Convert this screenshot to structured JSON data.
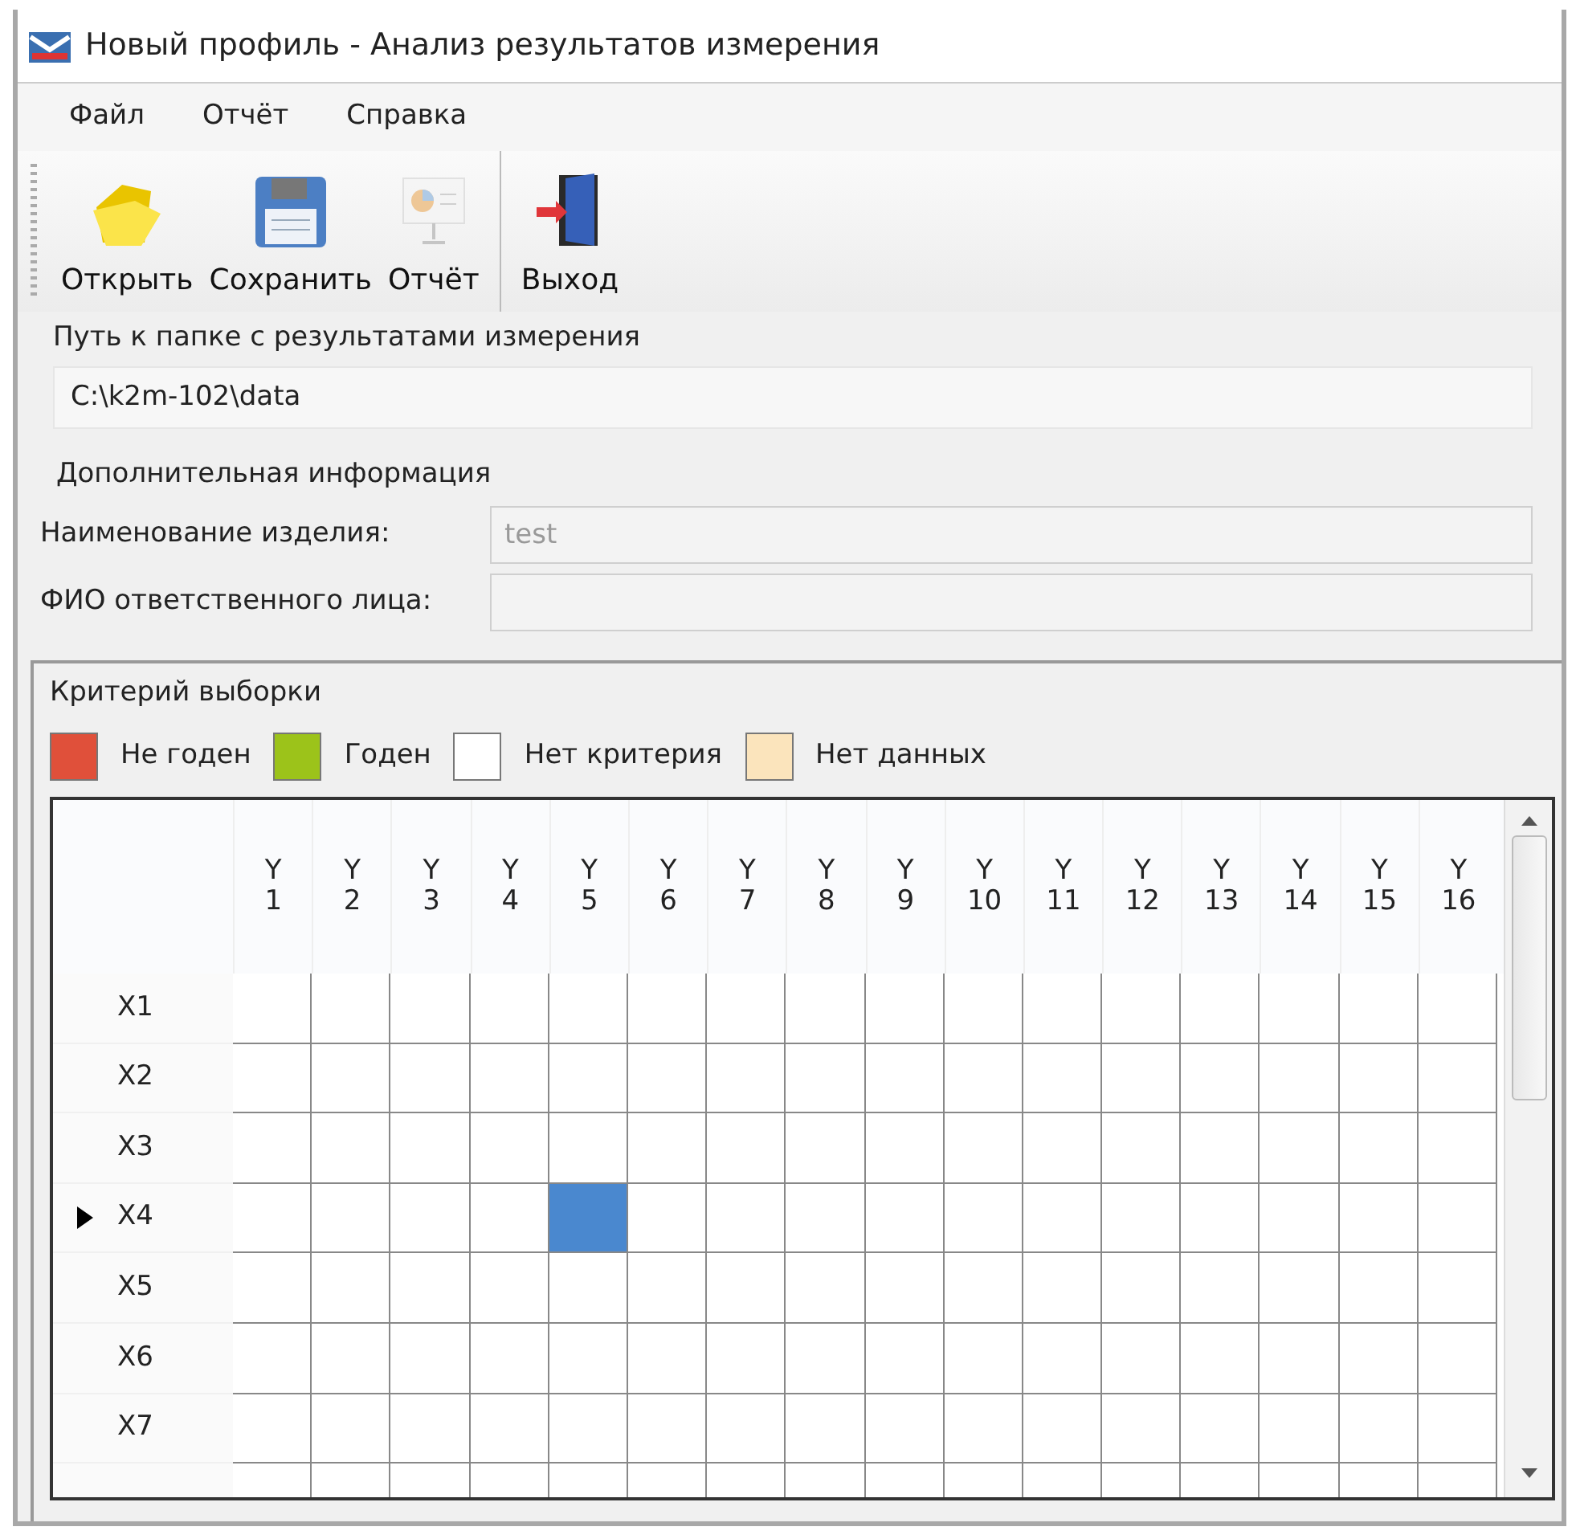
{
  "window": {
    "title": "Новый профиль - Анализ результатов измерения"
  },
  "menu": [
    {
      "label": "Файл"
    },
    {
      "label": "Отчёт"
    },
    {
      "label": "Справка"
    }
  ],
  "toolbar": [
    {
      "kind": "open",
      "label": "Открыть",
      "disabled": false,
      "separator_before": false
    },
    {
      "kind": "save",
      "label": "Сохранить",
      "disabled": false,
      "separator_before": false
    },
    {
      "kind": "report",
      "label": "Отчёт",
      "disabled": true,
      "separator_before": false
    },
    {
      "kind": "exit",
      "label": "Выход",
      "disabled": false,
      "separator_before": true
    }
  ],
  "path_group": {
    "title": "Путь к папке с результатами измерения",
    "value": "C:\\k2m-102\\data"
  },
  "info_group": {
    "title": "Дополнительная информация",
    "fields": [
      {
        "label": "Наименование изделия:",
        "value": "test",
        "disabled": true
      },
      {
        "label": "ФИО ответственного лица:",
        "disabled": true
      }
    ]
  },
  "criteria": {
    "title": "Критерий выборки",
    "legend": [
      {
        "label": "Не годен",
        "color": "#e0503a"
      },
      {
        "label": "Годен",
        "color": "#9cc31a"
      },
      {
        "label": "Нет критерия",
        "color": "#ffffff"
      },
      {
        "label": "Нет данных",
        "color": "#fbe4bc"
      }
    ]
  },
  "grid": {
    "columns": [
      "Y 1",
      "Y 2",
      "Y 3",
      "Y 4",
      "Y 5",
      "Y 6",
      "Y 7",
      "Y 8",
      "Y 9",
      "Y 10",
      "Y 11",
      "Y 12",
      "Y 13",
      "Y 14",
      "Y 15",
      "Y 16"
    ],
    "rows": [
      {
        "label": "X1",
        "current": false,
        "cells": [
          {
            "selected": false
          },
          {
            "selected": false
          },
          {
            "selected": false
          },
          {
            "selected": false
          },
          {
            "selected": false
          },
          {
            "selected": false
          },
          {
            "selected": false
          },
          {
            "selected": false
          },
          {
            "selected": false
          },
          {
            "selected": false
          },
          {
            "selected": false
          },
          {
            "selected": false
          },
          {
            "selected": false
          },
          {
            "selected": false
          },
          {
            "selected": false
          },
          {
            "selected": false
          }
        ]
      },
      {
        "label": "X2",
        "current": false,
        "cells": [
          {
            "selected": false
          },
          {
            "selected": false
          },
          {
            "selected": false
          },
          {
            "selected": false
          },
          {
            "selected": false
          },
          {
            "selected": false
          },
          {
            "selected": false
          },
          {
            "selected": false
          },
          {
            "selected": false
          },
          {
            "selected": false
          },
          {
            "selected": false
          },
          {
            "selected": false
          },
          {
            "selected": false
          },
          {
            "selected": false
          },
          {
            "selected": false
          },
          {
            "selected": false
          }
        ]
      },
      {
        "label": "X3",
        "current": false,
        "cells": [
          {
            "selected": false
          },
          {
            "selected": false
          },
          {
            "selected": false
          },
          {
            "selected": false
          },
          {
            "selected": false
          },
          {
            "selected": false
          },
          {
            "selected": false
          },
          {
            "selected": false
          },
          {
            "selected": false
          },
          {
            "selected": false
          },
          {
            "selected": false
          },
          {
            "selected": false
          },
          {
            "selected": false
          },
          {
            "selected": false
          },
          {
            "selected": false
          },
          {
            "selected": false
          }
        ]
      },
      {
        "label": "X4",
        "current": true,
        "cells": [
          {
            "selected": false
          },
          {
            "selected": false
          },
          {
            "selected": false
          },
          {
            "selected": false
          },
          {
            "selected": true
          },
          {
            "selected": false
          },
          {
            "selected": false
          },
          {
            "selected": false
          },
          {
            "selected": false
          },
          {
            "selected": false
          },
          {
            "selected": false
          },
          {
            "selected": false
          },
          {
            "selected": false
          },
          {
            "selected": false
          },
          {
            "selected": false
          },
          {
            "selected": false
          }
        ]
      },
      {
        "label": "X5",
        "current": false,
        "cells": [
          {
            "selected": false
          },
          {
            "selected": false
          },
          {
            "selected": false
          },
          {
            "selected": false
          },
          {
            "selected": false
          },
          {
            "selected": false
          },
          {
            "selected": false
          },
          {
            "selected": false
          },
          {
            "selected": false
          },
          {
            "selected": false
          },
          {
            "selected": false
          },
          {
            "selected": false
          },
          {
            "selected": false
          },
          {
            "selected": false
          },
          {
            "selected": false
          },
          {
            "selected": false
          }
        ]
      },
      {
        "label": "X6",
        "current": false,
        "cells": [
          {
            "selected": false
          },
          {
            "selected": false
          },
          {
            "selected": false
          },
          {
            "selected": false
          },
          {
            "selected": false
          },
          {
            "selected": false
          },
          {
            "selected": false
          },
          {
            "selected": false
          },
          {
            "selected": false
          },
          {
            "selected": false
          },
          {
            "selected": false
          },
          {
            "selected": false
          },
          {
            "selected": false
          },
          {
            "selected": false
          },
          {
            "selected": false
          },
          {
            "selected": false
          }
        ]
      },
      {
        "label": "X7",
        "current": false,
        "cells": [
          {
            "selected": false
          },
          {
            "selected": false
          },
          {
            "selected": false
          },
          {
            "selected": false
          },
          {
            "selected": false
          },
          {
            "selected": false
          },
          {
            "selected": false
          },
          {
            "selected": false
          },
          {
            "selected": false
          },
          {
            "selected": false
          },
          {
            "selected": false
          },
          {
            "selected": false
          },
          {
            "selected": false
          },
          {
            "selected": false
          },
          {
            "selected": false
          },
          {
            "selected": false
          }
        ]
      }
    ]
  }
}
